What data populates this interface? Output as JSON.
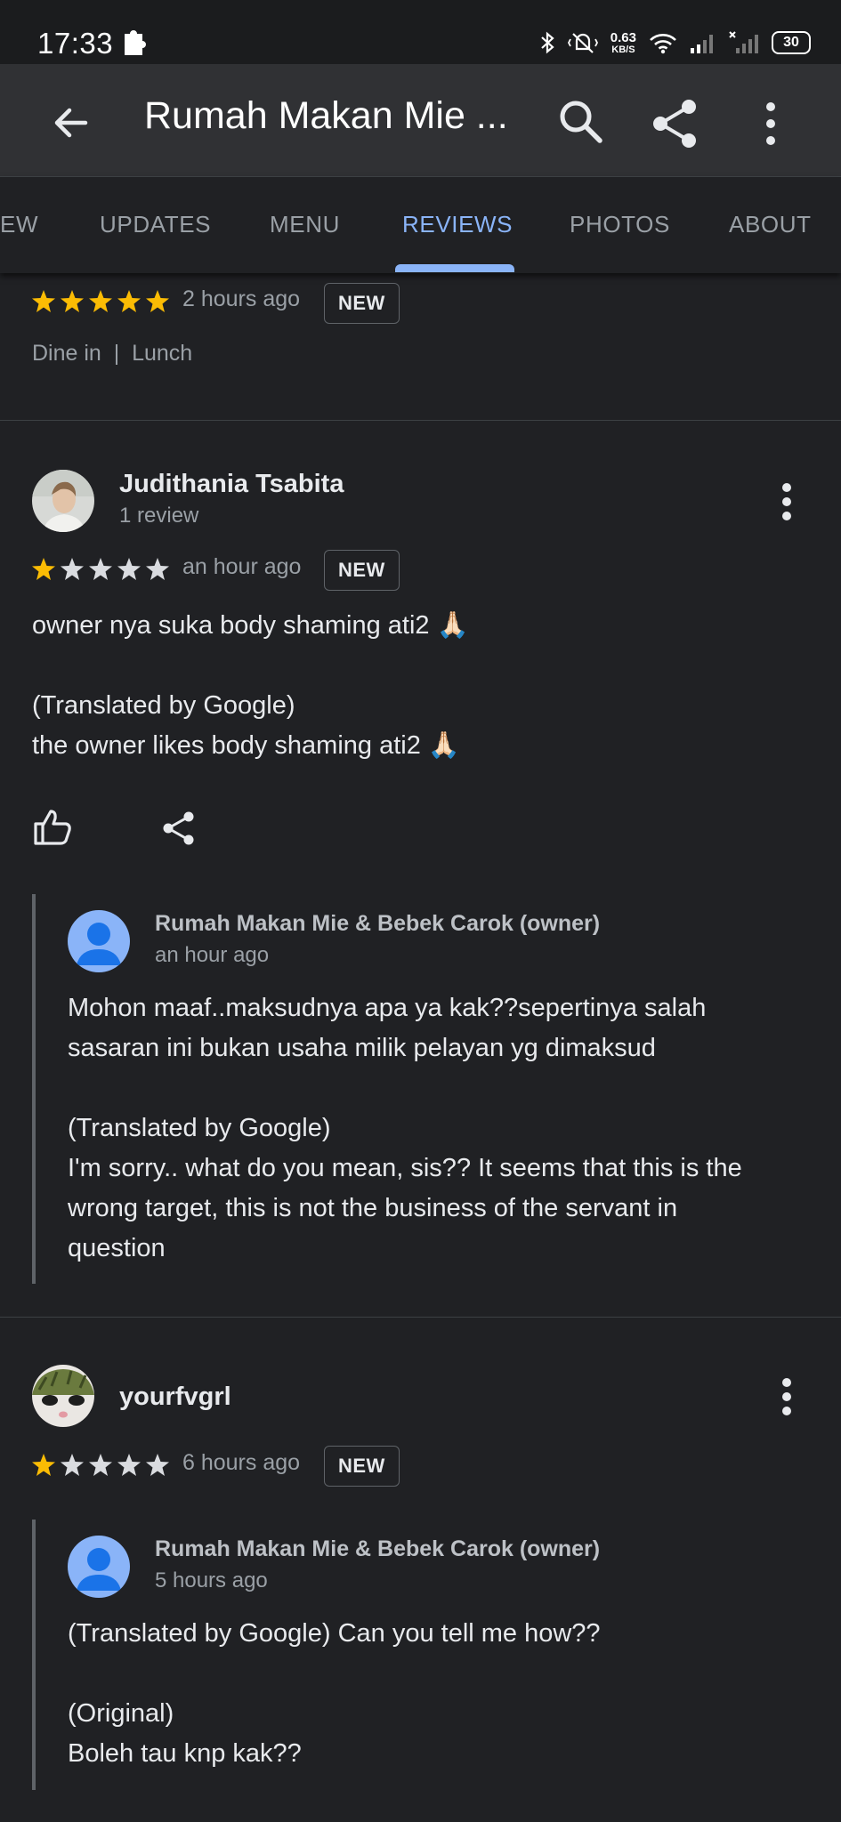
{
  "status": {
    "time": "17:33",
    "net_speed_value": "0.63",
    "net_speed_unit": "KB/S",
    "battery": "30"
  },
  "app_bar": {
    "title": "Rumah Makan Mie ...",
    "icons": [
      "arrow-back-icon",
      "search-icon",
      "share-icon",
      "more-vert-icon"
    ]
  },
  "tabs": [
    {
      "label": "EW"
    },
    {
      "label": "UPDATES"
    },
    {
      "label": "MENU"
    },
    {
      "label": "REVIEWS",
      "active": true
    },
    {
      "label": "PHOTOS"
    },
    {
      "label": "ABOUT"
    }
  ],
  "reviews": [
    {
      "rating": 5,
      "time": "2 hours ago",
      "badge": "NEW",
      "tags": "Dine in  |  Lunch"
    },
    {
      "author": "Judithania Tsabita",
      "author_sub": "1 review",
      "rating": 1,
      "time": "an hour ago",
      "badge": "NEW",
      "text": "owner nya suka body shaming ati2 🙏🏻\n\n(Translated by Google)\nthe owner likes body shaming ati2 🙏🏻",
      "reply": {
        "author": "Rumah Makan Mie & Bebek Carok (owner)",
        "time": "an hour ago",
        "text": "Mohon maaf..maksudnya apa ya kak??sepertinya salah\nsasaran ini bukan usaha milik pelayan yg dimaksud\n\n(Translated by Google)\nI'm sorry.. what do you mean, sis?? It seems that this is the\nwrong target, this is not the business of the servant in\nquestion"
      }
    },
    {
      "author": "yourfvgrl",
      "rating": 1,
      "time": "6 hours ago",
      "badge": "NEW",
      "reply": {
        "author": "Rumah Makan Mie & Bebek Carok (owner)",
        "time": "5 hours ago",
        "text": "(Translated by Google) Can you tell me how??\n\n(Original)\nBoleh tau knp kak??"
      }
    }
  ],
  "colors": {
    "background": "#202124",
    "accent": "#8ab4f8",
    "star_filled": "#fbbc04",
    "star_empty": "#dadce0"
  }
}
